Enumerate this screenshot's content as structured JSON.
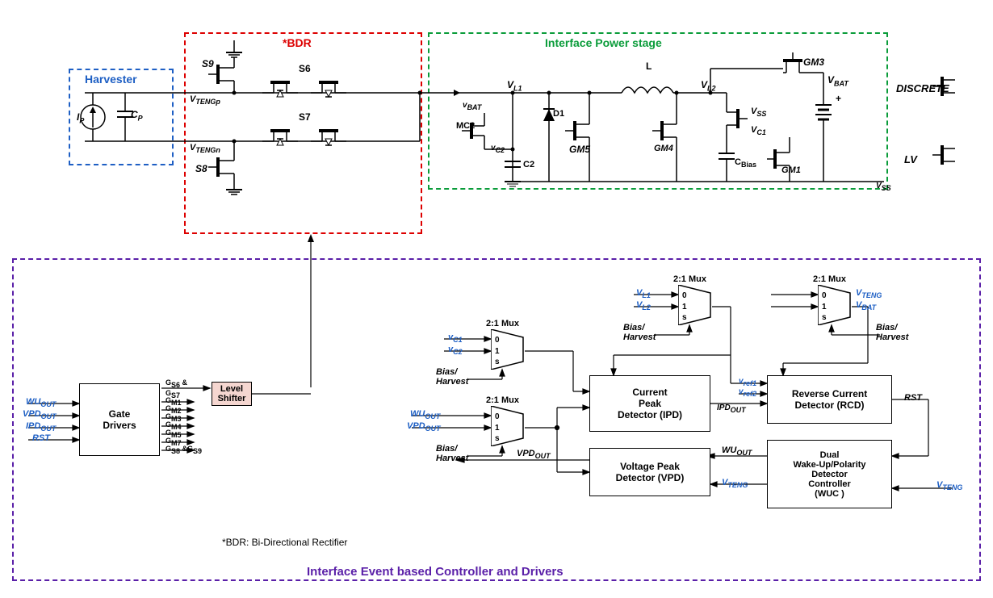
{
  "regions": {
    "harvester": {
      "title": "Harvester"
    },
    "bdr": {
      "title": "*BDR"
    },
    "power_stage": {
      "title": "Interface Power stage"
    },
    "controller": {
      "title": "Interface Event based Controller and Drivers"
    }
  },
  "footnote": "*BDR: Bi-Directional Rectifier",
  "blocks": {
    "gate_drivers": "Gate\nDrivers",
    "level_shifter": "Level\nShifter",
    "ipd": "Current\nPeak\nDetector (IPD)",
    "vpd": "Voltage Peak\nDetector (VPD)",
    "rcd": "Reverse Current\nDetector (RCD)",
    "wuc": "Dual\nWake-Up/Polarity\nDetector\nController\n(WUC )"
  },
  "mux_label": "2:1 Mux",
  "mux_internal": {
    "zero": "0",
    "one": "1",
    "sel": "s"
  },
  "signals": {
    "ip": "I",
    "ip_sub": "P",
    "cp": "C",
    "cp_sub": "P",
    "s9": "S9",
    "s8": "S8",
    "s6": "S6",
    "s7": "S7",
    "vtengp": "V",
    "vtengp_sub": "TENGp",
    "vtengn": "V",
    "vtengn_sub": "TENGn",
    "vl1": "V",
    "vl1_sub": "L1",
    "vl2": "V",
    "vl2_sub": "L2",
    "vbat": "V",
    "vbat_sub": "BAT",
    "vbat_lower": "v",
    "vbat_lower_sub": "BAT",
    "mc2": "MC2",
    "vc2": "v",
    "vc2_sub": "C2",
    "c2": "C2",
    "d1": "D1",
    "gm5": "GM5",
    "gm4": "GM4",
    "gm3": "GM3",
    "gm1": "GM1",
    "l": "L",
    "vss": "V",
    "vss_sub": "SS",
    "vc1": "V",
    "vc1_sub": "C1",
    "cbias": "C",
    "cbias_sub": "Bias",
    "discrete": "DISCRETE",
    "lv": "LV",
    "vss_node": "V",
    "vss_node_sub": "SS",
    "wu_out": "WU",
    "wu_out_sub": "OUT",
    "vpd_out": "VPD",
    "vpd_out_sub": "OUT",
    "ipd_out": "IPD",
    "ipd_out_sub": "OUT",
    "rst": "RST",
    "gs6s7": "G",
    "gs6s7_sub": "S6",
    "gs6s7_and": " &",
    "gs7_sub": "S7",
    "gm1l": "G",
    "gm1_sub": "M1",
    "gm2l": "G",
    "gm2_sub": "M2",
    "gm3l": "G",
    "gm3_sub": "M3",
    "gm4l": "G",
    "gm4_sub": "M4",
    "gm5l": "G",
    "gm5_sub": "M5",
    "gm7l": "G",
    "gm7_sub": "M7",
    "gs8s9": "G",
    "gs8_sub": "S8",
    "gs8s9_and": " &G",
    "gs9_sub": "S9",
    "mux_vc1": "v",
    "mux_vc1_sub": "C1",
    "mux_vc2": "v",
    "mux_vc2_sub": "C2",
    "mux_vl1": "V",
    "mux_vl1_sub": "L1",
    "mux_vl2": "V",
    "mux_vl2_sub": "L2",
    "mux_vteng": "V",
    "mux_vteng_sub": "TENG",
    "mux_vbat": "V",
    "mux_vbat_sub": "BAT",
    "bias_harvest": "Bias/\nHarvest",
    "vref1": "v",
    "vref1_sub": "ref1",
    "vref2": "v",
    "vref2_sub": "ref2",
    "vteng": "V",
    "vteng_sub": "TENG"
  }
}
